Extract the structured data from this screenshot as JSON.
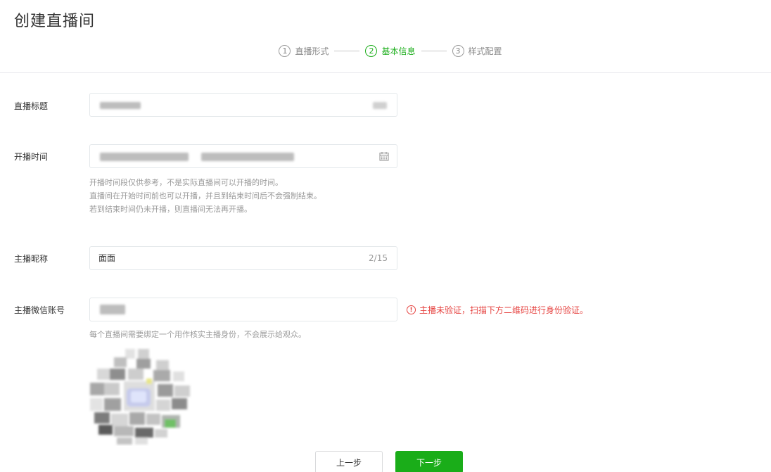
{
  "page": {
    "title": "创建直播间"
  },
  "steps": [
    {
      "num": "1",
      "label": "直播形式",
      "active": false
    },
    {
      "num": "2",
      "label": "基本信息",
      "active": true
    },
    {
      "num": "3",
      "label": "样式配置",
      "active": false
    }
  ],
  "form": {
    "title_label": "直播标题",
    "time_label": "开播时间",
    "time_help": [
      "开播时间段仅供参考，不是实际直播间可以开播的时间。",
      "直播间在开始时间前也可以开播，并且到结束时间后不会强制结束。",
      "若到结束时间仍未开播，则直播间无法再开播。"
    ],
    "nickname_label": "主播昵称",
    "nickname_value": "面面",
    "nickname_counter": "2/15",
    "wechat_label": "主播微信账号",
    "wechat_warning": "主播未验证，扫描下方二维码进行身份验证。",
    "wechat_warning_icon": "!",
    "wechat_help": "每个直播间需要绑定一个用作核实主播身份，不会展示给观众。"
  },
  "buttons": {
    "prev": "上一步",
    "next": "下一步"
  },
  "colors": {
    "accent": "#1aad19",
    "error": "#e64340"
  }
}
